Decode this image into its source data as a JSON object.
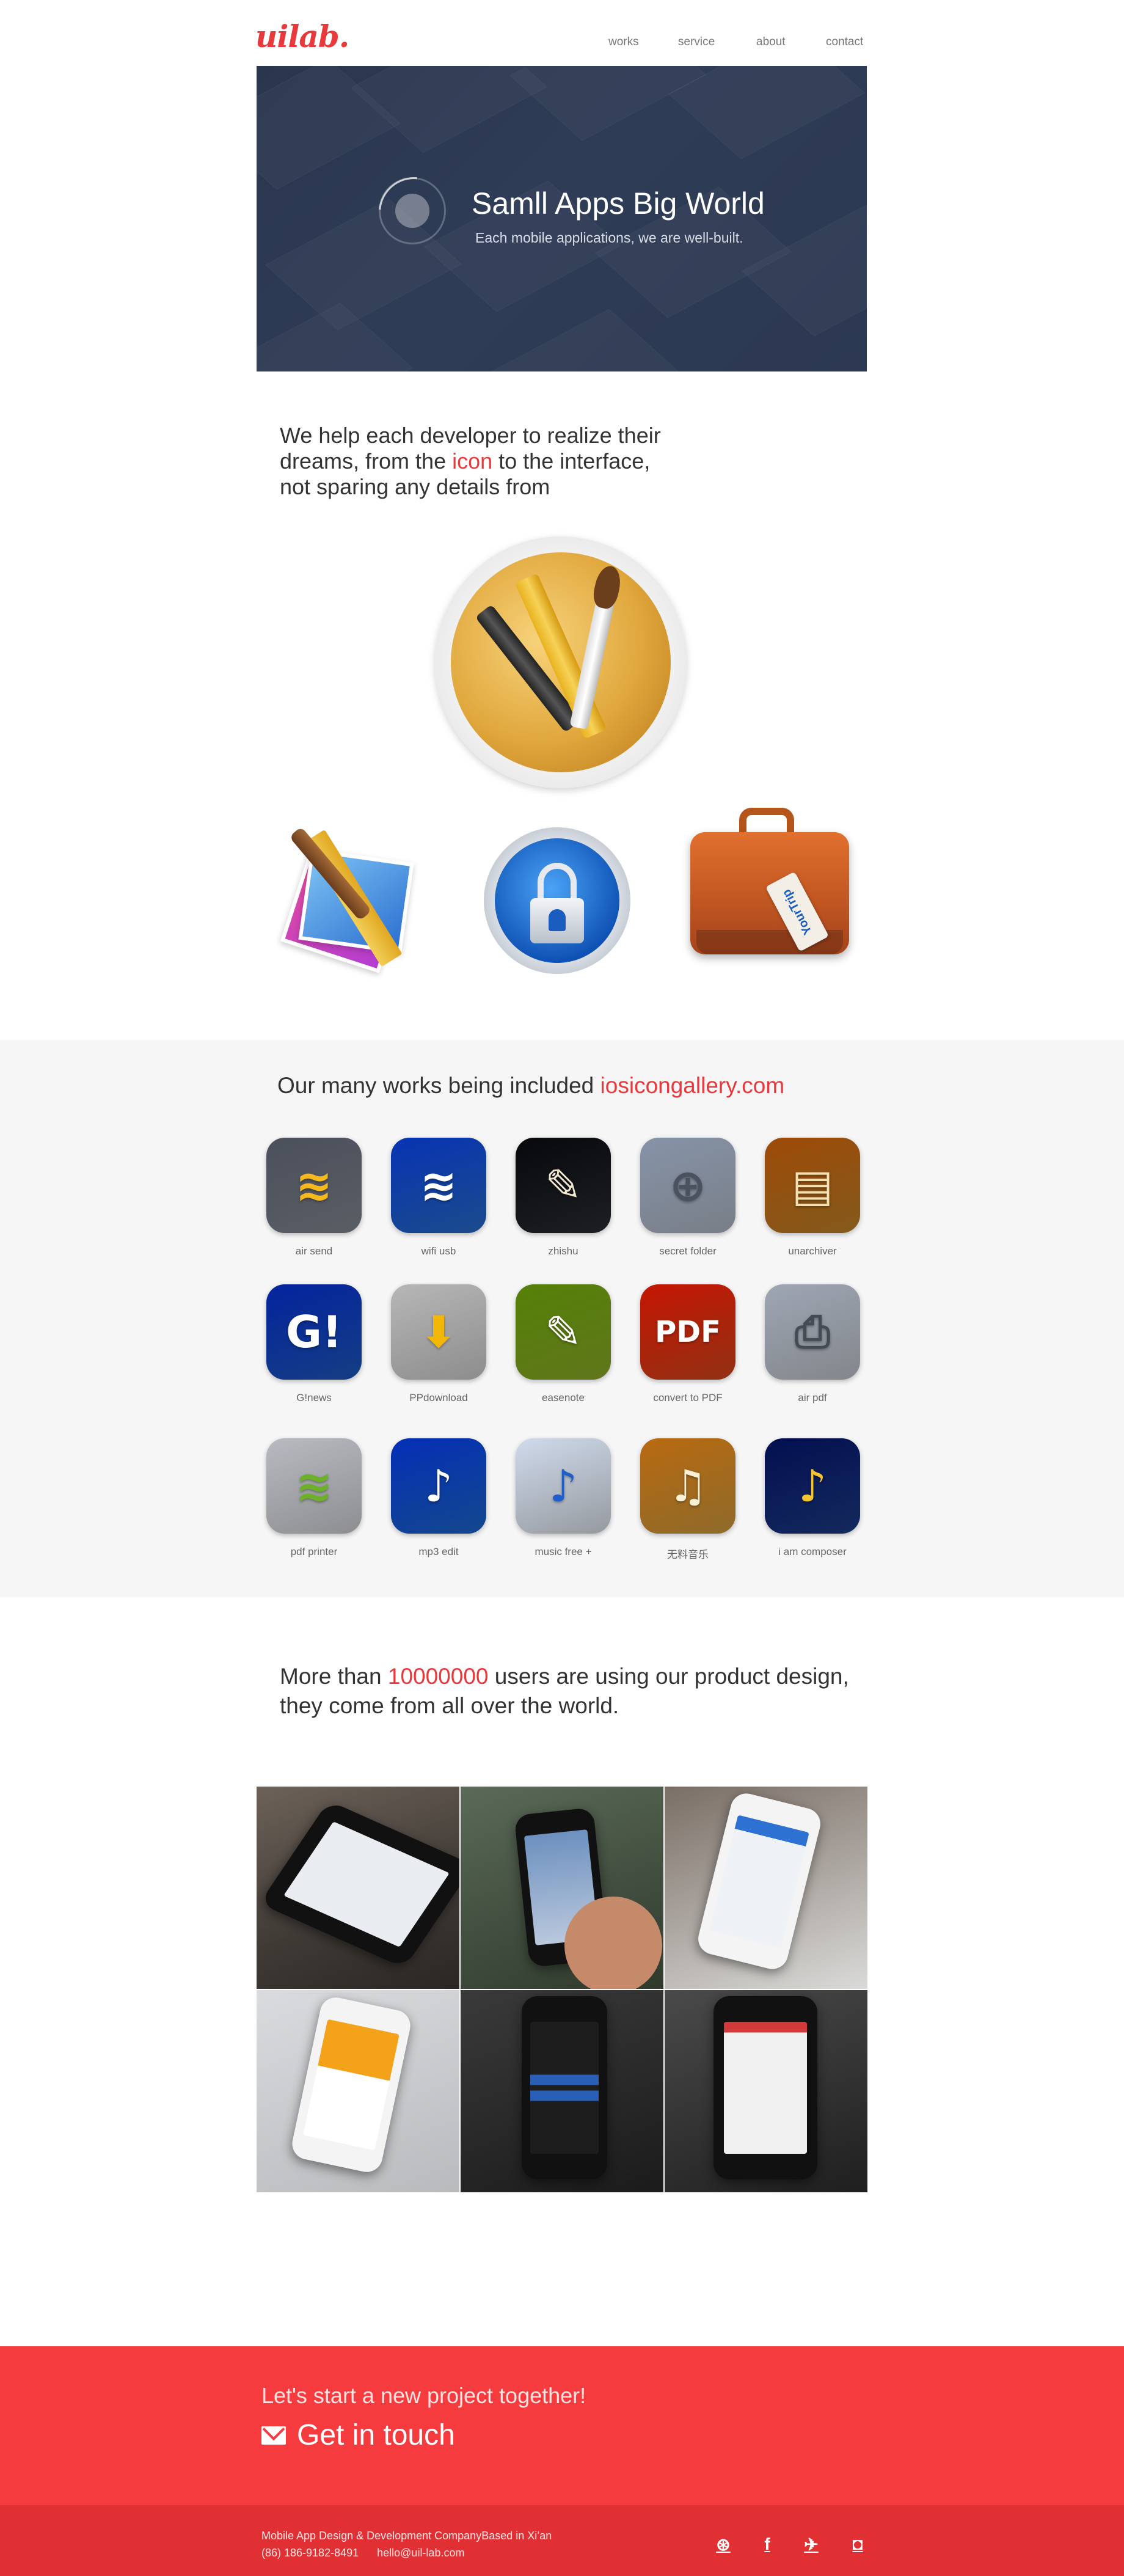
{
  "header": {
    "logo": "uilab.",
    "nav": [
      "works",
      "service",
      "about",
      "contact"
    ]
  },
  "hero": {
    "title": "Samll Apps Big World",
    "subtitle": "Each mobile applications, we are well-built."
  },
  "intro": {
    "line1": "We help each developer to realize their",
    "line2_pre": "dreams, from the ",
    "line2_highlight": "icon",
    "line2_post": " to the interface,",
    "line3": "not sparing any details from"
  },
  "showcase": {
    "suitcase_tag": "YourTrip"
  },
  "works": {
    "title_pre": "Our many works being included ",
    "title_link": "iosicongallery.com",
    "apps": [
      {
        "label": "air send",
        "icon": "folder-wifi-icon",
        "bg": "#8a8f99",
        "glyph": "≋",
        "fg": "#f6b91d"
      },
      {
        "label": "wifi usb",
        "icon": "usb-wifi-icon",
        "bg": "#2a73d6",
        "glyph": "≋",
        "fg": "#ffffff"
      },
      {
        "label": "zhishu",
        "icon": "book-icon",
        "bg": "#2b2f36",
        "glyph": "✎",
        "fg": "#f1e6cf"
      },
      {
        "label": "secret folder",
        "icon": "secret-folder-icon",
        "bg": "#b9c2cf",
        "glyph": "⊕",
        "fg": "#4a5260"
      },
      {
        "label": "unarchiver",
        "icon": "archive-drawer-icon",
        "bg": "#c98a2c",
        "glyph": "▤",
        "fg": "#f4e0b0"
      },
      {
        "label": "G!news",
        "icon": "news-icon",
        "bg": "#1f5fc9",
        "glyph": "G!",
        "fg": "#ffffff"
      },
      {
        "label": "PPdownload",
        "icon": "download-music-icon",
        "bg": "#d8d8d8",
        "glyph": "⬇",
        "fg": "#f2b705"
      },
      {
        "label": "easenote",
        "icon": "notebook-icon",
        "bg": "#93b52b",
        "glyph": "✎",
        "fg": "#ffffff"
      },
      {
        "label": "convert to PDF",
        "icon": "pdf-icon",
        "bg": "#e04b1d",
        "glyph": "PDF",
        "fg": "#ffffff"
      },
      {
        "label": "air pdf",
        "icon": "printer-icon",
        "bg": "#c9ced6",
        "glyph": "⎙",
        "fg": "#444b55"
      },
      {
        "label": "pdf printer",
        "icon": "wifi-printer-icon",
        "bg": "#d9dade",
        "glyph": "≋",
        "fg": "#6fb02a"
      },
      {
        "label": "mp3 edit",
        "icon": "music-note-edit-icon",
        "bg": "#1d6ed8",
        "glyph": "♪",
        "fg": "#ffffff"
      },
      {
        "label": "music free +",
        "icon": "music-disc-icon",
        "bg": "#e6ecf5",
        "glyph": "♪",
        "fg": "#1f5fc9"
      },
      {
        "label": "无料音乐",
        "icon": "music-frame-icon",
        "bg": "#d9a441",
        "glyph": "♫",
        "fg": "#fbf1d6"
      },
      {
        "label": "i am composer",
        "icon": "stage-note-icon",
        "bg": "#1e3f8f",
        "glyph": "♪",
        "fg": "#f5c531"
      }
    ]
  },
  "users": {
    "line1_pre": "More than ",
    "line1_highlight": "10000000",
    "line1_post": " users are using our product design,",
    "line2": "they come from all over the world."
  },
  "cta": {
    "text": "Let's start a new project together!",
    "button": "Get in touch"
  },
  "footer": {
    "company": "Mobile App Design & Development CompanyBased in Xi’an",
    "phone": "(86) 186-9182-8491",
    "email": "hello@uil-lab.com",
    "social": [
      {
        "name": "dribbble-icon",
        "glyph": "⊛"
      },
      {
        "name": "facebook-icon",
        "glyph": "f"
      },
      {
        "name": "twitter-icon",
        "glyph": "✈"
      },
      {
        "name": "instagram-icon",
        "glyph": "◘"
      }
    ]
  }
}
